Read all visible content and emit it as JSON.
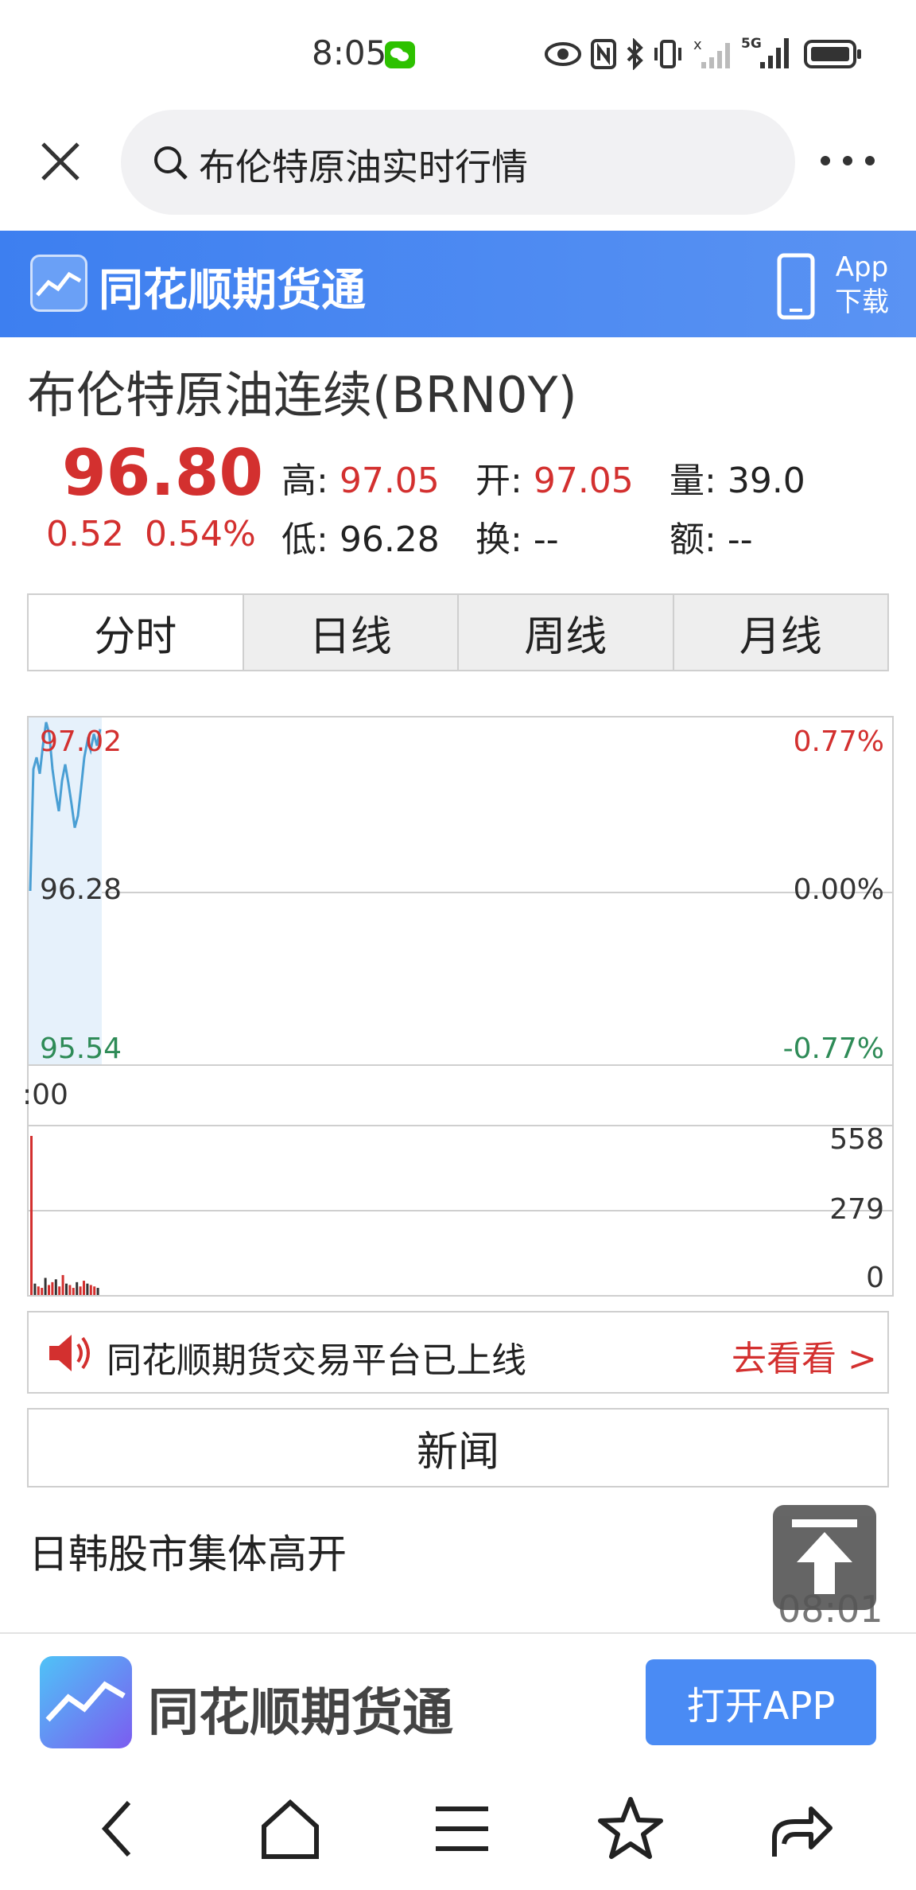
{
  "status_bar": {
    "time": "8:05",
    "icons": [
      "wechat-icon",
      "eye-icon",
      "nfc-icon",
      "bluetooth-icon",
      "vibrate-icon",
      "signal-icon",
      "5g-signal-icon",
      "battery-icon"
    ]
  },
  "search": {
    "query": "布伦特原油实时行情"
  },
  "banner": {
    "title": "同花顺期货通",
    "app_download": "App下载",
    "app_download_line1": "App",
    "app_download_line2": "下载",
    "color": "#4a89f2"
  },
  "quote": {
    "title": "布伦特原油连续(BRN0Y)",
    "price": "96.80",
    "change": "0.52",
    "change_pct": "0.54%",
    "high_label": "高:",
    "high": "97.05",
    "open_label": "开:",
    "open": "97.05",
    "volume_label": "量:",
    "volume": "39.0",
    "low_label": "低:",
    "low": "96.28",
    "turnover_label": "换:",
    "turnover": "--",
    "amount_label": "额:",
    "amount": "--",
    "up_color": "#d3302f",
    "down_color": "#2e8b57"
  },
  "tabs": [
    {
      "label": "分时",
      "selected": true
    },
    {
      "label": "日线",
      "selected": false
    },
    {
      "label": "周线",
      "selected": false
    },
    {
      "label": "月线",
      "selected": false
    }
  ],
  "chart_data": {
    "type": "line",
    "y_top": "97.02",
    "y_mid": "96.28",
    "y_bottom": "95.54",
    "pct_top": "0.77%",
    "pct_mid": "0.00%",
    "pct_bottom": "-0.77%",
    "x_start_label": ":00",
    "ylim": [
      95.54,
      97.02
    ],
    "price_series": [
      96.28,
      96.8,
      96.85,
      96.78,
      96.9,
      97.0,
      96.95,
      96.8,
      96.7,
      96.62,
      96.75,
      96.82,
      96.74,
      96.65,
      96.55,
      96.6,
      96.72,
      96.85,
      96.92,
      96.88,
      96.95,
      96.9,
      96.97
    ],
    "volume_labels": [
      "558",
      "279",
      "0"
    ],
    "volume_ylim": [
      0,
      558
    ],
    "volume_series": [
      558,
      40,
      30,
      25,
      60,
      35,
      45,
      55,
      30,
      70,
      40,
      35,
      25,
      45,
      30,
      50,
      40,
      35,
      30,
      25
    ],
    "line_color": "#4a9fd4"
  },
  "promo": {
    "text": "同花顺期货交易平台已上线",
    "link": "去看看 >"
  },
  "news": {
    "header": "新闻",
    "items": [
      {
        "title": "日韩股市集体高开",
        "time": "08:01"
      }
    ]
  },
  "app_bar": {
    "title": "同花顺期货通",
    "open_button": "打开APP"
  },
  "nav_bar": {
    "icons": [
      "back-icon",
      "home-icon",
      "menu-icon",
      "star-icon",
      "share-icon"
    ]
  }
}
